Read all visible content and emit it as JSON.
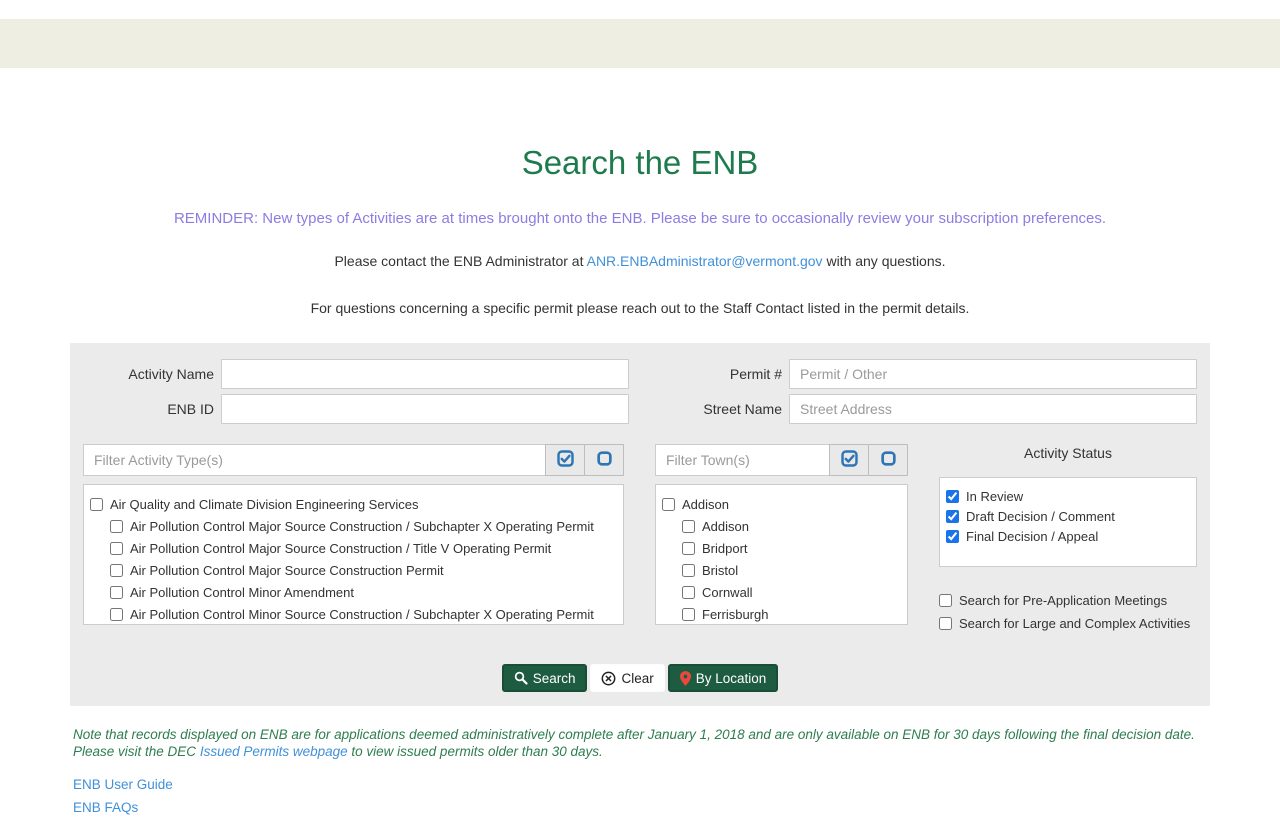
{
  "header": {
    "title": "Search the ENB",
    "reminder": "REMINDER: New types of Activities are at times brought onto the ENB. Please be sure to occasionally review your subscription preferences.",
    "contact_prefix": "Please contact the ENB Administrator at ",
    "contact_email": "ANR.ENBAdministrator@vermont.gov",
    "contact_suffix": " with any questions.",
    "questions_note": "For questions concerning a specific permit please reach out to the Staff Contact listed in the permit details."
  },
  "form": {
    "fields": {
      "activity_name": {
        "label": "Activity Name",
        "value": "",
        "placeholder": ""
      },
      "permit_number": {
        "label": "Permit #",
        "value": "",
        "placeholder": "Permit / Other"
      },
      "enb_id": {
        "label": "ENB ID",
        "value": "",
        "placeholder": ""
      },
      "street_name": {
        "label": "Street Name",
        "value": "",
        "placeholder": "Street Address"
      }
    },
    "activity_filter": {
      "placeholder": "Filter Activity Type(s)"
    },
    "town_filter": {
      "placeholder": "Filter Town(s)"
    },
    "activity_tree": {
      "parent": {
        "label": "Air Quality and Climate Division Engineering Services",
        "checked": false
      },
      "children": [
        {
          "label": "Air Pollution Control Major Source Construction / Subchapter X Operating Permit",
          "checked": false
        },
        {
          "label": "Air Pollution Control Major Source Construction / Title V Operating Permit",
          "checked": false
        },
        {
          "label": "Air Pollution Control Major Source Construction Permit",
          "checked": false
        },
        {
          "label": "Air Pollution Control Minor Amendment",
          "checked": false
        },
        {
          "label": "Air Pollution Control Minor Source Construction / Subchapter X Operating Permit",
          "checked": false
        }
      ]
    },
    "town_tree": {
      "parent": {
        "label": "Addison",
        "checked": false
      },
      "children": [
        {
          "label": "Addison",
          "checked": false
        },
        {
          "label": "Bridport",
          "checked": false
        },
        {
          "label": "Bristol",
          "checked": false
        },
        {
          "label": "Cornwall",
          "checked": false
        },
        {
          "label": "Ferrisburgh",
          "checked": false
        }
      ]
    },
    "activity_status": {
      "title": "Activity Status",
      "options": [
        {
          "label": "In Review",
          "checked": true
        },
        {
          "label": "Draft Decision / Comment",
          "checked": true
        },
        {
          "label": "Final Decision / Appeal",
          "checked": true
        }
      ]
    },
    "extra_options": [
      {
        "label": "Search for Pre-Application Meetings",
        "checked": false
      },
      {
        "label": "Search for Large and Complex Activities",
        "checked": false
      }
    ],
    "buttons": {
      "search": "Search",
      "clear": "Clear",
      "by_location": "By Location"
    }
  },
  "footer": {
    "note_part1": "Note that records displayed on ENB are for applications deemed administratively complete after January 1, 2018 and are only available on ENB for 30 days following the final decision date. Please visit the DEC ",
    "note_link": "Issued Permits webpage",
    "note_part2": " to view issued permits older than 30 days.",
    "links": [
      {
        "label": "ENB User Guide"
      },
      {
        "label": "ENB FAQs"
      }
    ]
  },
  "colors": {
    "banner_beige": "#eeeee2",
    "panel_gray": "#ebebeb",
    "title_green": "#1e7b4d",
    "button_green": "#1e5c41",
    "reminder_purple": "#8c7de2",
    "link_blue": "#4090d9",
    "note_green": "#2e7d4f",
    "checkbox_blue": "#1a73e8",
    "filter_icon_blue": "#2e75b5",
    "marker_red": "#e8483e"
  }
}
